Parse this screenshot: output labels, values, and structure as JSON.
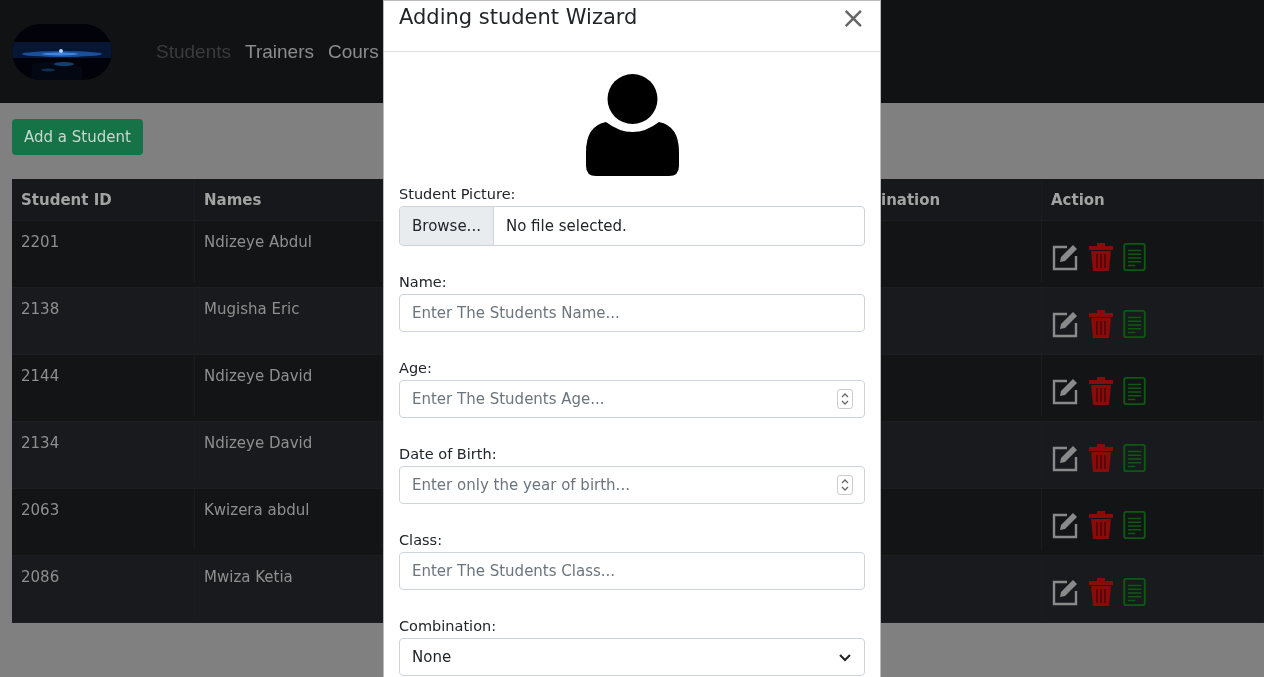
{
  "navbar": {
    "links": [
      {
        "label": "Students",
        "disabled": true
      },
      {
        "label": "Trainers",
        "disabled": false
      },
      {
        "label": "Cours",
        "disabled": false
      }
    ]
  },
  "add_button": "Add a Student",
  "table": {
    "columns": [
      "Student ID",
      "Names",
      "",
      "ination",
      "Action"
    ],
    "rows": [
      {
        "id": "2201",
        "name": "Ndizeye Abdul"
      },
      {
        "id": "2138",
        "name": "Mugisha Eric"
      },
      {
        "id": "2144",
        "name": "Ndizeye David"
      },
      {
        "id": "2134",
        "name": "Ndizeye David"
      },
      {
        "id": "2063",
        "name": "Kwizera abdul"
      },
      {
        "id": "2086",
        "name": "Mwiza Ketia"
      }
    ]
  },
  "modal": {
    "title": "Adding student Wizard",
    "close": "×",
    "fields": [
      {
        "kind": "file",
        "label": "Student Picture:",
        "button": "Browse...",
        "value": "No file selected."
      },
      {
        "kind": "text",
        "label": "Name:",
        "placeholder": "Enter The Students Name..."
      },
      {
        "kind": "number",
        "label": "Age:",
        "placeholder": "Enter The Students Age..."
      },
      {
        "kind": "number",
        "label": "Date of Birth:",
        "placeholder": "Enter only the year of birth..."
      },
      {
        "kind": "text",
        "label": "Class:",
        "placeholder": "Enter The Students Class..."
      },
      {
        "kind": "select",
        "label": "Combination:",
        "value": "None"
      }
    ]
  }
}
